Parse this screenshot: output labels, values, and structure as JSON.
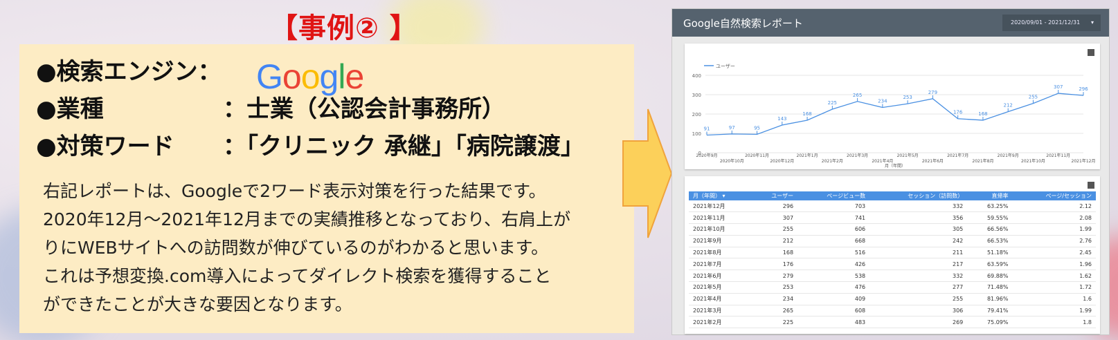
{
  "slide": {
    "title": "【事例② 】",
    "bullets": [
      {
        "label": "●検索エンジン：",
        "value": ""
      },
      {
        "label": "●業種",
        "value": "：士業（公認会計事務所）"
      },
      {
        "label": "●対策ワード",
        "value": "：「クリニック 承継」「病院譲渡」"
      }
    ],
    "google_logo": [
      "G",
      "o",
      "o",
      "g",
      "l",
      "e"
    ],
    "description": [
      "右記レポートは、Googleで2ワード表示対策を行った結果です。",
      "2020年12月～2021年12月までの実績推移となっており、右肩上が",
      "りにWEBサイトへの訪問数が伸びているのがわかると思います。",
      "これは予想変換.com導入によってダイレクト検索を獲得すること",
      "ができたことが大きな要因となります。"
    ]
  },
  "report": {
    "title": "Google自然検索レポート",
    "date_range": "2020/09/01 - 2021/12/31",
    "dropdown_icon": "▾",
    "table": {
      "headers": [
        "月（年間） ▾",
        "ユーザー",
        "ページビュー数",
        "セッション（訪問数）",
        "直帰率",
        "ページ/セッション"
      ],
      "rows": [
        [
          "2021年12月",
          "296",
          "703",
          "332",
          "63.25%",
          "2.12"
        ],
        [
          "2021年11月",
          "307",
          "741",
          "356",
          "59.55%",
          "2.08"
        ],
        [
          "2021年10月",
          "255",
          "606",
          "305",
          "66.56%",
          "1.99"
        ],
        [
          "2021年9月",
          "212",
          "668",
          "242",
          "66.53%",
          "2.76"
        ],
        [
          "2021年8月",
          "168",
          "516",
          "211",
          "51.18%",
          "2.45"
        ],
        [
          "2021年7月",
          "176",
          "426",
          "217",
          "63.59%",
          "1.96"
        ],
        [
          "2021年6月",
          "279",
          "538",
          "332",
          "69.88%",
          "1.62"
        ],
        [
          "2021年5月",
          "253",
          "476",
          "277",
          "71.48%",
          "1.72"
        ],
        [
          "2021年4月",
          "234",
          "409",
          "255",
          "81.96%",
          "1.6"
        ],
        [
          "2021年3月",
          "265",
          "608",
          "306",
          "79.41%",
          "1.99"
        ],
        [
          "2021年2月",
          "225",
          "483",
          "269",
          "75.09%",
          "1.8"
        ]
      ]
    }
  },
  "chart_data": {
    "type": "line",
    "x": [
      "2020年9月",
      "2020年10月",
      "2020年11月",
      "2020年12月",
      "2021年1月",
      "2021年2月",
      "2021年3月",
      "2021年4月",
      "2021年5月",
      "2021年6月",
      "2021年7月",
      "2021年8月",
      "2021年9月",
      "2021年10月",
      "2021年11月",
      "2021年12月"
    ],
    "series": [
      {
        "name": "ユーザー",
        "values": [
          91,
          97,
          95,
          143,
          168,
          225,
          265,
          234,
          253,
          279,
          176,
          168,
          212,
          255,
          307,
          296
        ]
      }
    ],
    "yticks": [
      0,
      100,
      200,
      300,
      400
    ],
    "ylim": [
      0,
      400
    ],
    "xlabel": "月（年間）",
    "ylabel": "",
    "legend_position": "top-left",
    "grid": true,
    "color": "#4a90e2"
  }
}
